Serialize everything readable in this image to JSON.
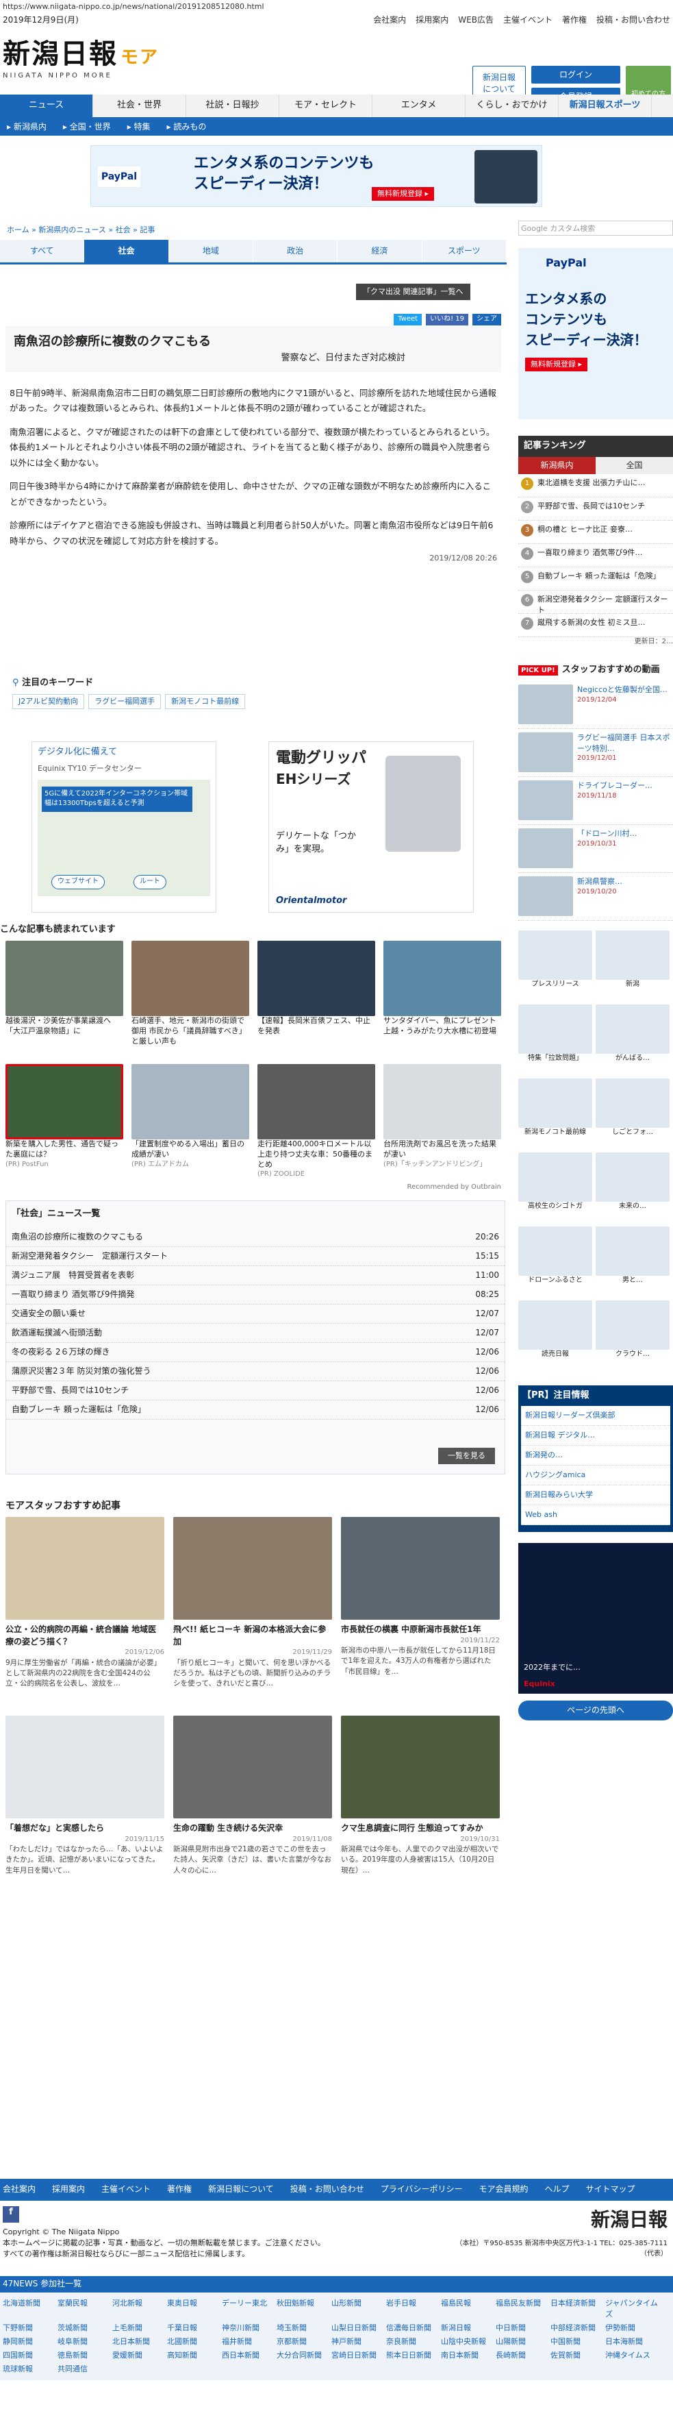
{
  "url": "https://www.niigata-nippo.co.jp/news/national/20191208512080.html",
  "date_line": "2019年12月9日(月)",
  "top_links": [
    "会社案内",
    "採用案内",
    "WEB広告",
    "主催イベント",
    "著作権",
    "投稿・お問い合わせ"
  ],
  "logo": {
    "text": "新潟日報",
    "moa": "モア",
    "sub": "NIIGATA NIPPO MORE"
  },
  "header_buttons": {
    "about": "新潟日報\nについて",
    "login": "ログイン",
    "register": "会員登録",
    "new": "初めての方"
  },
  "gnav": [
    "ニュース",
    "社会・世界",
    "社説・日報抄",
    "モア・セレクト",
    "エンタメ",
    "くらし・おでかけ",
    "新潟日報スポーツ"
  ],
  "subnav": [
    "新潟県内",
    "全国・世界",
    "特集",
    "読みもの"
  ],
  "banner": {
    "title": "エンタメ系のコンテンツも",
    "title2": "スピーディー決済！",
    "cta": "無料新規登録 ▸",
    "brand": "PayPal"
  },
  "breadcrumb": [
    "ホーム",
    "新潟県内のニュース",
    "社会",
    "記事"
  ],
  "cat_tabs": [
    "すべて",
    "社会",
    "地域",
    "政治",
    "経済",
    "スポーツ"
  ],
  "related_btn": "「クマ出没 関連記事」一覧へ",
  "share": {
    "tweet": "Tweet",
    "like": "いいね! 19",
    "share": "シェア"
  },
  "article": {
    "title": "南魚沼の診療所に複数のクマこもる",
    "subtitle": "警察など、日付またぎ対応検討",
    "paras": [
      "8日午前9時半、新潟県南魚沼市二日町の鵜気原二日町診療所の敷地内にクマ1頭がいると、同診療所を訪れた地域住民から通報があった。クマは複数頭いるとみられ、体長約1メートルと体長不明の2頭が確わっていることが確認された。",
      "南魚沼署によると、クマが確認されたのは軒下の倉庫として使われている部分で、複数頭が横たわっているとみられるという。体長約1メートルとそれより小さい体長不明の2頭が確認され、ライトを当てると動く様子があり、診療所の職員や入院患者ら以外には全く動かない。",
      "同日午後3時半から4時にかけて麻酔業者が麻酔銃を使用し、命中させたが、クマの正確な頭数が不明なため診療所内に入ることができなかったという。",
      "診療所にはデイケアと宿泊できる施設も併設され、当時は職員と利用者ら計50人がいた。同署と南魚沼市役所などは9日午前6時半から、クマの状況を確認して対応方針を検討する。"
    ],
    "time": "2019/12/08 20:26"
  },
  "keywords": {
    "title": "注目のキーワード",
    "items": [
      "J2アルビ契約動向",
      "ラグビー福岡選手",
      "新潟モノコト最前線"
    ]
  },
  "ads": {
    "map_title": "デジタル化に備えて",
    "map_sub": "Equinix TY10 データセンター",
    "map_cta": "5Gに備えて2022年インターコネクション帯域幅は13300Tbpsを超えると予測",
    "route": "ウェブサイト",
    "route2": "ルート",
    "motor_t1": "電動グリッパ",
    "motor_t2": "EHシリーズ",
    "motor_t3": "デリケートな「つかみ」を実現。",
    "motor_brand": "Orientalmotor"
  },
  "recommend": {
    "title": "こんな記事も読まれています",
    "items": [
      "越後湯沢・沙美佐が事業譲渡へ「大江戸温泉物語」に",
      "石崎選手、地元・新潟市の街頭で御用 市民から「議員辞職すべき」と厳しい声も",
      "【速報】長岡米百俵フェス、中止を発表",
      "サンタダイバー、魚にプレゼント 上越・うみがたり大水槽に初登場",
      "新築を購入した男性、通告で疑った裏庭には？",
      "「建置制度やめる入場出」蓄日の成績が凄い",
      "走行距離400,000キロメートル以上走り持つ丈夫な車：50番種のまとめ",
      "台所用洗剤でお風呂を洗った結果が凄い"
    ],
    "sources": [
      "(PR) PostFun",
      "(PR) エムアドカム",
      "(PR) ZOOLIDE",
      "(PR)「キッチンアンドリビング」"
    ],
    "outbrain": "Recommended by Outbrain"
  },
  "newslist": {
    "title": "「社会」ニュース一覧",
    "rows": [
      [
        "南魚沼の診療所に複数のクマこもる",
        "20:26"
      ],
      [
        "新潟空港発着タクシー　定額運行スタート",
        "15:15"
      ],
      [
        "満ジュニア展　特賞受賞者を表彰",
        "11:00"
      ],
      [
        "一喜取り締まり 酒気帯び9件摘発",
        "08:25"
      ],
      [
        "交通安全の願い乗せ",
        "12/07"
      ],
      [
        "飲酒運転撲滅へ街頭活動",
        "12/07"
      ],
      [
        "冬の夜彩る 2６万球の輝き",
        "12/06"
      ],
      [
        "蒲原沢災害2３年 防災対策の強化誓う",
        "12/06"
      ],
      [
        "平野部で雪、長岡では10センチ",
        "12/06"
      ],
      [
        "自動ブレーキ 頼った運転は「危険」",
        "12/06"
      ]
    ],
    "more": "一覧を見る"
  },
  "staff": {
    "title": "モアスタッフおすすめ記事",
    "items": [
      {
        "t": "公立・公的病院の再編・統合議論 地域医療の姿どう描く？",
        "d": "2019/12/06",
        "x": "9月に厚生労働省が「再編・統合の議論が必要」として新潟県内の22病院を含む全国424の公立・公的病院名を公表し、波紋を…"
      },
      {
        "t": "飛べ!! 紙ヒコーキ 新潟の本格派大会に参加",
        "d": "2019/11/29",
        "x": "「折り紙ヒコーキ」と聞いて、何を思い浮かべるだろうか。私は子どもの頃、新聞折り込みのチラシを使って、きれいだと喜び…"
      },
      {
        "t": "市長就任の横裏 中原新潟市長就任1年",
        "d": "2019/11/22",
        "x": "新潟市の中原八一市長が就任してから11月18日で1年を迎えた。43万人の有権者から選ばれた「市民目線」を…"
      },
      {
        "t": "「着想だな」と実感したら",
        "d": "2019/11/15",
        "x": "「わたしだけ」ではなかったら…「あ、いよいよきたか」。近頃、記憶があいまいになってきた。生年月日を聞いて…"
      },
      {
        "t": "生命の躍動 生き続ける矢沢幸",
        "d": "2019/11/08",
        "x": "新潟県見附市出身で21歳の若さでこの世を去った詩人、矢沢幸（きだ）は、書いた言葉が今なお人々の心に…"
      },
      {
        "t": "クマ生息調査に同行 生態迫ってすみか",
        "d": "2019/10/31",
        "x": "新潟県では今年も、人里でのクマ出没が相次いでいる。2019年度の人身被害は15人（10月20日現在）…"
      }
    ]
  },
  "side": {
    "ad_title": "エンタメ系の",
    "ad_title2": "コンテンツも",
    "ad_title3": "スピーディー決済！",
    "ad_cta": "無料新規登録 ▸",
    "ranking_title": "記事ランキング",
    "ranking_tabs": [
      "新潟県内",
      "全国"
    ],
    "ranking": [
      "東北道横を支援 出張力チ山に…",
      "平野部で雪、長岡では10センチ",
      "桐の槽と ヒーナ比正 妾寮…",
      "一喜取り締まり 酒気帯び9件…",
      "自動ブレーキ 頼った運転は「危険」",
      "新潟空港発着タクシー 定額運行スタート",
      "蹴飛する新潟の女性 初ミス旦…"
    ],
    "updated": "更新日：2…",
    "pickup_title": "スタッフおすすめの動画",
    "pickup": [
      {
        "t": "Negiccoと佐藤製が全国…",
        "d": "2019/12/04"
      },
      {
        "t": "ラグビー福岡選手 日本スポーツ特別…",
        "d": "2019/12/01"
      },
      {
        "t": "ドライブレコーダー…",
        "d": "2019/11/18"
      },
      {
        "t": "「ドローン川村…",
        "d": "2019/10/31"
      },
      {
        "t": "新潟県警察…",
        "d": "2019/10/20"
      }
    ],
    "services": [
      "プレスリリース",
      "新潟",
      "特集「拉致問題」",
      "がんばる…",
      "新潟モノコト最前線",
      "しごとフォ…",
      "高校生のシゴトガ",
      "未来の…",
      "ドローンふるさと",
      "男と…",
      "読売日報",
      "クラウド…"
    ],
    "pr_title": "【PR】注目情報",
    "pr_items": [
      "新潟日報リーダーズ倶楽部",
      "新潟日報 デジタル…",
      "新潟発の…",
      "ハウジングamica",
      "新潟日報みらい大学",
      "Web ash"
    ],
    "bottom_ad": "2022年までに…",
    "bottom_ad2": "Equinix",
    "page_top": "ページの先頭へ"
  },
  "footer": {
    "links": [
      "会社案内",
      "採用案内",
      "主催イベント",
      "著作権",
      "新潟日報について",
      "投稿・お問い合わせ",
      "プライバシーポリシー",
      "モア会員規約",
      "ヘルプ",
      "サイトマップ"
    ],
    "copyright": "Copyright © The Niigata Nippo",
    "notice1": "本ホームページに掲載の記事・写真・動画など、一切の無断転載を禁じます。ご注意ください。",
    "notice2": "すべての著作権は新潟日報社ならびに一部ニュース配信社に帰属します。",
    "news47": "47NEWS 参加社一覧",
    "address": "（本社）〒950-8535 新潟市中央区万代3-1-1 TEL：025-385-7111（代表）",
    "papers": [
      "北海道新聞",
      "室蘭民報",
      "河北新報",
      "東奥日報",
      "デーリー東北",
      "秋田魁新報",
      "山形新聞",
      "岩手日報",
      "福島民報",
      "福島民友新聞",
      "日本経済新聞",
      "ジャパンタイムズ",
      "下野新聞",
      "茨城新聞",
      "上毛新聞",
      "千葉日報",
      "神奈川新聞",
      "埼玉新聞",
      "山梨日日新聞",
      "信濃毎日新聞",
      "新潟日報",
      "中日新聞",
      "中部経済新聞",
      "伊勢新聞",
      "静岡新聞",
      "岐阜新聞",
      "北日本新聞",
      "北國新聞",
      "福井新聞",
      "京都新聞",
      "神戸新聞",
      "奈良新聞",
      "山陰中央新報",
      "山陽新聞",
      "中国新聞",
      "日本海新聞",
      "四国新聞",
      "徳島新聞",
      "愛媛新聞",
      "高知新聞",
      "西日本新聞",
      "大分合同新聞",
      "宮崎日日新聞",
      "熊本日日新聞",
      "南日本新聞",
      "長崎新聞",
      "佐賀新聞",
      "沖縄タイムス",
      "琉球新報",
      "共同通信"
    ]
  }
}
